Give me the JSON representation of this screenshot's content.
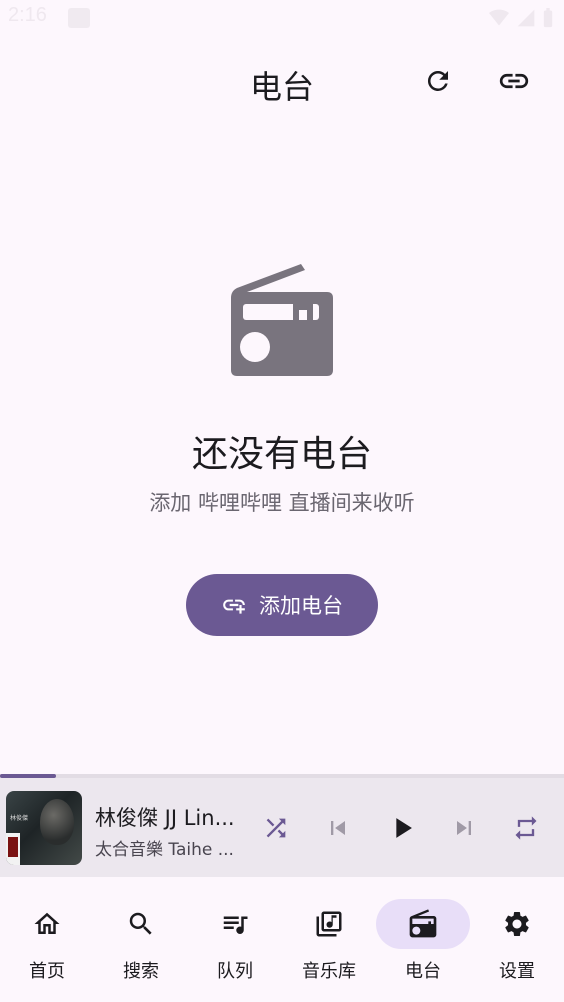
{
  "status": {
    "time": "2:16"
  },
  "header": {
    "title": "电台"
  },
  "empty_state": {
    "icon": "radio-icon",
    "title": "还没有电台",
    "subtitle": "添加 哔哩哔哩 直播间来收听"
  },
  "add_button": {
    "label": "添加电台",
    "icon": "add-link-icon"
  },
  "player": {
    "title": "林俊傑 JJ Lin...",
    "artist": "太合音樂 Taihe ...",
    "progress_fraction": 0.1,
    "album_art_text": "林俊傑"
  },
  "nav": {
    "items": [
      {
        "label": "首页",
        "icon": "home-icon"
      },
      {
        "label": "搜索",
        "icon": "search-icon"
      },
      {
        "label": "队列",
        "icon": "queue-icon"
      },
      {
        "label": "音乐库",
        "icon": "library-icon"
      },
      {
        "label": "电台",
        "icon": "radio-icon",
        "active": true
      },
      {
        "label": "设置",
        "icon": "gear-icon"
      }
    ]
  },
  "colors": {
    "accent": "#6b5993",
    "background": "#fdf7fd",
    "player_bg": "#ece7ee",
    "active_pill": "#e8def8"
  }
}
